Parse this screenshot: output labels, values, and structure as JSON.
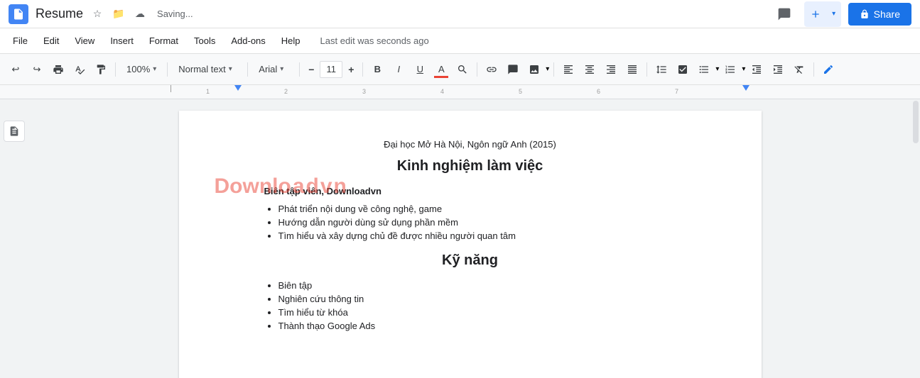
{
  "titlebar": {
    "app_icon_label": "Docs",
    "doc_title": "Resume",
    "saving_text": "Saving...",
    "comment_icon": "💬",
    "new_icon": "+",
    "share_label": "Share"
  },
  "menubar": {
    "items": [
      "File",
      "Edit",
      "View",
      "Insert",
      "Format",
      "Tools",
      "Add-ons",
      "Help"
    ],
    "last_edit": "Last edit was seconds ago"
  },
  "toolbar": {
    "undo_icon": "↩",
    "redo_icon": "↪",
    "print_icon": "🖨",
    "paint_icon": "🎨",
    "pointer_icon": "↖",
    "zoom_value": "100%",
    "zoom_arrow": "▾",
    "style_value": "Normal text",
    "style_arrow": "▾",
    "font_value": "Arial",
    "font_arrow": "▾",
    "font_size": "11",
    "minus_label": "−",
    "plus_label": "+",
    "bold_label": "B",
    "italic_label": "I",
    "underline_label": "U",
    "text_color_label": "A",
    "highlight_label": "✏",
    "link_label": "🔗",
    "comment_label": "💬",
    "image_label": "🖼",
    "image_arrow": "▾",
    "align_left": "≡",
    "align_center": "≡",
    "align_right": "≡",
    "align_justify": "≡",
    "line_spacing": "↕",
    "format_clear": "✕"
  },
  "document": {
    "university": "Đại học Mở Hà Nội, Ngôn ngữ Anh (2015)",
    "work_section_title": "Kinh nghiệm làm việc",
    "job_title": "Biên tập viên, Downloadvn",
    "work_items": [
      "Phát triển nội dung về công nghệ, game",
      "Hướng dẫn người dùng sử dụng phần mềm",
      "Tìm hiểu và xây dựng chủ đề được nhiều người quan tâm"
    ],
    "skills_section_title": "Kỹ năng",
    "skills_items": [
      "Biên tập",
      "Nghiên cứu thông tin",
      "Tìm hiểu từ khóa",
      "Thành thạo Google Ads"
    ],
    "watermark": "Downl..."
  }
}
